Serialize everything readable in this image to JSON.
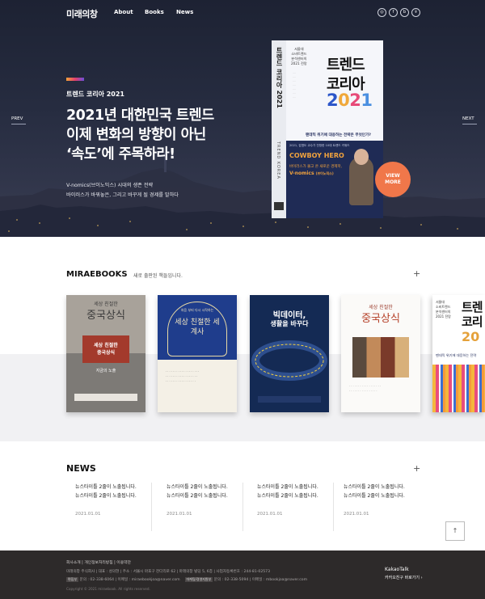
{
  "header": {
    "logo": "미래의창",
    "nav": [
      "About",
      "Books",
      "News"
    ],
    "social_icons": [
      "instagram-icon",
      "facebook-icon",
      "blog-icon",
      "location-icon"
    ],
    "social_glyphs": [
      "◎",
      "f",
      "b",
      "⌾"
    ]
  },
  "hero": {
    "kicker": "트렌드 코리아 2021",
    "headline": [
      "2021년 대한민국 트렌드",
      "이제 변화의 방향이 아닌",
      "‘속도’에 주목하라!"
    ],
    "desc": [
      "V-nomics(브이노믹스) 시대의 생존 전략",
      "바이러스가 바꿔놓은, 그리고 바꾸게 될 경제를 말하다"
    ],
    "prev": "PREV",
    "next": "NEXT",
    "view_more": [
      "VIEW",
      "MORE"
    ],
    "book": {
      "spine_title": "트렌드 코리아 2021",
      "spine_brand": "TREND KOREA",
      "authors": "서울대\n소비트렌드\n분석센터의\n2021 전망",
      "title1": "트렌드",
      "title2": "코리아",
      "year": "2021",
      "subtitle": "팬데믹 위기에 대응하는 전략은 무엇인가?",
      "cowboy": "COWBOY HERO",
      "vnomics": "바이러스가 몰고 온 새로운 경제학,",
      "vnomics2": "V-nomics",
      "vnomics3": "(브이노믹스)",
      "small": "2021, 감염도 교수가 전망한 10대 트렌드 키워드"
    }
  },
  "miraebooks": {
    "title": "MIRAEBOOKS",
    "subtitle": "새로 출판된 책들입니다.",
    "plus": "+",
    "books": [
      {
        "top": "세상 친절한",
        "main": "중국상식",
        "sub": "지금의 노출"
      },
      {
        "top": "처음 부터 다시 시작하는",
        "main": "세상 친절한 세계사"
      },
      {
        "main": "빅데이터,",
        "main2": "생활을 바꾸다"
      },
      {
        "top": "세상 친절한",
        "main": "중국상식"
      },
      {
        "main": "트렌",
        "main2": "코리",
        "year": "20",
        "sub": "팬데믹 위기에 대응하는 전략"
      }
    ]
  },
  "news": {
    "title": "NEWS",
    "plus": "+",
    "items": [
      {
        "line1": "뉴스타이틀 2줄이 노출됩니다.",
        "line2": "뉴스타이틀 2줄이 노출됩니다.",
        "date": "2021.01.01"
      },
      {
        "line1": "뉴스타이틀 2줄이 노출됩니다.",
        "line2": "뉴스타이틀 2줄이 노출됩니다.",
        "date": "2021.01.01"
      },
      {
        "line1": "뉴스타이틀 2줄이 노출됩니다.",
        "line2": "뉴스타이틀 2줄이 노출됩니다.",
        "date": "2021.01.01"
      },
      {
        "line1": "뉴스타이틀 2줄이 노출됩니다.",
        "line2": "뉴스타이틀 2줄이 노출됩니다.",
        "date": "2021.01.01"
      }
    ],
    "top_button": "↑"
  },
  "footer": {
    "links": "회사소개  |  개인정보처리방침  |  이용약관",
    "info1": "미래의창 주식회사  |  대표 : 성의현  |  주소 : 서울시 마포구 잔다리로 62  |  마래의창 빌딩 5, 6층  |  사업자등록번호 : 244-81-02573",
    "tag1": "편집부",
    "info2a": "문의 : 02-338-6064  |  이메일 : miraebookjoa@naver.com",
    "tag2": "마케팅/경영지원부",
    "info2b": "문의 : 02-338-5094  |  이메일 : mbookjoa@naver.com",
    "copyright": "Copyright © 2021 miraebook. All rights reserved.",
    "kakao_brand": "KakaoTalk",
    "kakao_cta": "카카오친구 바로가기  ›"
  }
}
